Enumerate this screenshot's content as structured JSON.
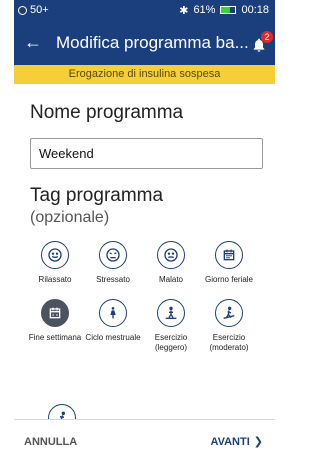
{
  "status": {
    "left_text": "50+",
    "battery_text": "61%",
    "time": "00:18"
  },
  "appbar": {
    "title": "Modifica programma ba...",
    "notifications_count": "2"
  },
  "banner": {
    "text": "Erogazione di insulina sospesa"
  },
  "program_name": {
    "title": "Nome programma",
    "value": "Weekend"
  },
  "tags": {
    "title": "Tag programma",
    "subtitle": "(opzionale)",
    "items": [
      {
        "label": "Rilassato",
        "icon": "relaxed-face-icon",
        "selected": false
      },
      {
        "label": "Stressato",
        "icon": "stressed-face-icon",
        "selected": false
      },
      {
        "label": "Malato",
        "icon": "sick-face-icon",
        "selected": false
      },
      {
        "label": "Giorno feriale",
        "icon": "calendar-icon",
        "selected": false
      },
      {
        "label": "Fine settimana",
        "icon": "calendar-weekend-icon",
        "selected": true
      },
      {
        "label": "Ciclo mestruale",
        "icon": "female-figure-icon",
        "selected": false
      },
      {
        "label": "Esercizio (leggero)",
        "icon": "walking-icon",
        "selected": false
      },
      {
        "label": "Esercizio (moderato)",
        "icon": "hiking-icon",
        "selected": false
      }
    ]
  },
  "footer": {
    "cancel_label": "ANNULLA",
    "next_label": "AVANTI"
  },
  "colors": {
    "primary": "#1b3f7d",
    "banner": "#f5cf3a",
    "selected_tag": "#4a5360",
    "badge": "#e02b2b"
  }
}
